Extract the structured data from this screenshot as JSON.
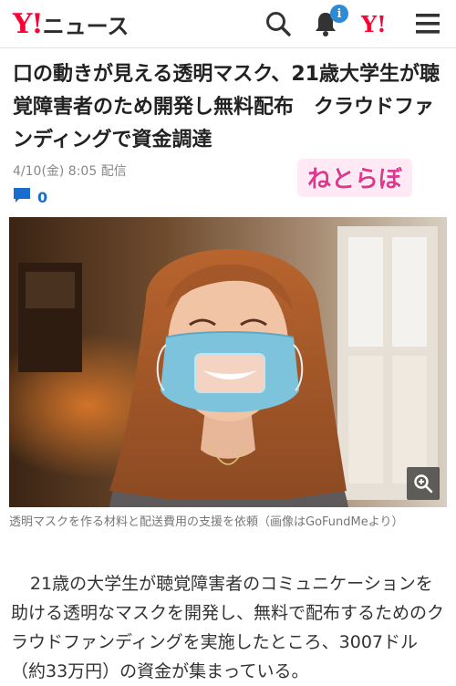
{
  "header": {
    "logo_mark": "Y!",
    "logo_text": "ニュース",
    "notification_badge": "i",
    "yahoo_mark": "Y!",
    "icons": [
      "search-icon",
      "bell-icon",
      "yahoo-logo",
      "menu-icon"
    ],
    "brand_color": "#ff0033",
    "badge_color": "#2c8ad6"
  },
  "article": {
    "title": "口の動きが見える透明マスク、21歳大学生が聴覚障害者のため開発し無料配布　クラウドファンディングで資金調達",
    "date": "4/10(金) 8:05 配信",
    "comment_count": "0",
    "source_logo": "ねとらぼ",
    "photo_caption": "透明マスクを作る材料と配送費用の支援を依頼（画像はGoFundMeより）",
    "body": "21歳の大学生が聴覚障害者のコミュニケーションを助ける透明なマスクを開発し、無料で配布するためのクラウドファンディングを実施したところ、3007ドル（約33万円）の資金が集まっている。"
  }
}
